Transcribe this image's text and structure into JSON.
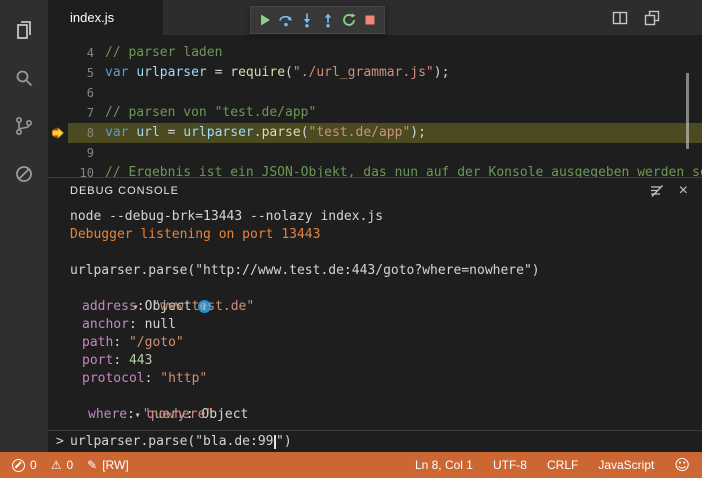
{
  "colors": {
    "status_bar_bg": "#CC6633",
    "current_line_bg": "#4B4A21",
    "comment": "#6A9955",
    "keyword": "#569CD6",
    "variable": "#9CDCFE",
    "function": "#DCDCAA",
    "string": "#CE9178",
    "console_key": "#C586C0",
    "console_number": "#B5CEA8",
    "stderr": "#E8823C",
    "info_badge": "#1E90D6"
  },
  "activity_bar": {
    "items": [
      {
        "name": "explorer"
      },
      {
        "name": "search"
      },
      {
        "name": "git"
      },
      {
        "name": "debug"
      }
    ]
  },
  "tab_bar": {
    "active_tab": "index.js"
  },
  "editor_actions": {
    "icons": [
      {
        "name": "split-editor"
      },
      {
        "name": "open-preview"
      }
    ]
  },
  "debug_toolbar": {
    "buttons": [
      {
        "name": "continue"
      },
      {
        "name": "step-over"
      },
      {
        "name": "step-into"
      },
      {
        "name": "step-out"
      },
      {
        "name": "restart"
      },
      {
        "name": "stop"
      }
    ]
  },
  "editor": {
    "lines": [
      {
        "num": "4",
        "tokens": [
          {
            "t": "// parser laden"
          }
        ]
      },
      {
        "num": "5",
        "tokens": [
          {
            "t": "var"
          },
          {
            "t": " "
          },
          {
            "t": "urlparser"
          },
          {
            "t": " = "
          },
          {
            "t": "require"
          },
          {
            "t": "("
          },
          {
            "t": "\"./url_grammar.js\""
          },
          {
            "t": ");"
          }
        ]
      },
      {
        "num": "6",
        "tokens": []
      },
      {
        "num": "7",
        "tokens": [
          {
            "t": "// parsen von \"test.de/app\""
          }
        ]
      },
      {
        "num": "8",
        "tokens": [
          {
            "t": "var"
          },
          {
            "t": " "
          },
          {
            "t": "url"
          },
          {
            "t": " = "
          },
          {
            "t": "urlparser"
          },
          {
            "t": "."
          },
          {
            "t": "parse"
          },
          {
            "t": "("
          },
          {
            "t": "\"test.de/app\""
          },
          {
            "t": ");"
          }
        ]
      },
      {
        "num": "9",
        "tokens": []
      },
      {
        "num": "10",
        "tokens": [
          {
            "t": "// Ergebnis ist ein JSON-Objekt, das nun auf der Konsole ausgegeben werden soll"
          }
        ]
      }
    ]
  },
  "debug_console": {
    "title": "DEBUG CONSOLE",
    "output": [
      {
        "text": "node --debug-brk=13443 --nolazy index.js"
      },
      {
        "text": "Debugger listening on port 13443"
      },
      {
        "text": ""
      },
      {
        "text": "urlparser.parse(\"http://www.test.de:443/goto?where=nowhere\")"
      }
    ],
    "result": {
      "twisty": "▾",
      "label": "Object",
      "info_glyph": "i",
      "sep": ": ",
      "properties": [
        {
          "key": "address",
          "value": "\"www.test.de\""
        },
        {
          "key": "anchor",
          "value": "null"
        },
        {
          "key": "path",
          "value": "\"/goto\""
        },
        {
          "key": "port",
          "value": "443"
        },
        {
          "key": "protocol",
          "value": "\"http\""
        },
        {
          "key": "query",
          "value": "Object"
        },
        {
          "key": "where",
          "value": "\"nowhere\""
        }
      ]
    },
    "input": {
      "prompt": ">",
      "value_before_cursor": "urlparser.parse(\"bla.de:99",
      "value_after_cursor": "\")"
    }
  },
  "status_bar": {
    "errors": "0",
    "warnings": "0",
    "warning_glyph": "⚠",
    "pencil_glyph": "✎",
    "file_mode": "[RW]",
    "cursor_position": "Ln 8, Col 1",
    "encoding": "UTF-8",
    "eol": "CRLF",
    "language": "JavaScript",
    "smiley_glyph": "☺"
  }
}
